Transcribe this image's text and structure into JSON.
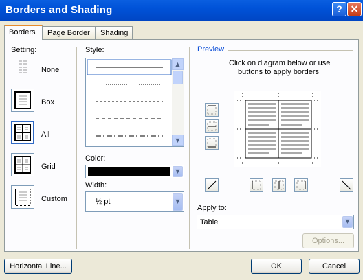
{
  "window": {
    "title": "Borders and Shading",
    "help_glyph": "?",
    "close_glyph": "✕"
  },
  "tabs": [
    {
      "label": "Borders",
      "active": true
    },
    {
      "label": "Page Border",
      "active": false
    },
    {
      "label": "Shading",
      "active": false
    }
  ],
  "setting": {
    "label": "Setting:",
    "items": [
      {
        "label": "None",
        "selected": false
      },
      {
        "label": "Box",
        "selected": false
      },
      {
        "label": "All",
        "selected": true
      },
      {
        "label": "Grid",
        "selected": false
      },
      {
        "label": "Custom",
        "selected": false
      }
    ]
  },
  "style": {
    "label": "Style:"
  },
  "color": {
    "label": "Color:",
    "value_color": "#000000"
  },
  "width": {
    "label": "Width:",
    "value": "½ pt"
  },
  "preview": {
    "label": "Preview",
    "instruction_line1": "Click on diagram below or use",
    "instruction_line2": "buttons to apply borders"
  },
  "apply_to": {
    "label": "Apply to:",
    "value": "Table"
  },
  "buttons": {
    "options": "Options...",
    "horizontal_line": "Horizontal Line...",
    "ok": "OK",
    "cancel": "Cancel"
  }
}
